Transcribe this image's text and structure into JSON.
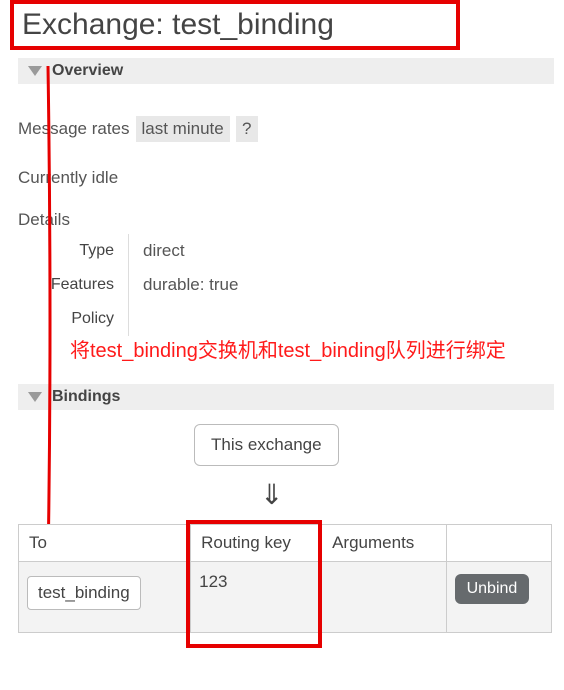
{
  "title": "Exchange: test_binding",
  "sections": {
    "overview": "Overview",
    "bindings": "Bindings"
  },
  "message_rates": {
    "label": "Message rates",
    "range": "last minute",
    "help": "?"
  },
  "idle": "Currently idle",
  "details": {
    "heading": "Details",
    "rows": {
      "type": {
        "label": "Type",
        "value": "direct"
      },
      "features": {
        "label": "Features",
        "value": "durable: true"
      },
      "policy": {
        "label": "Policy",
        "value": ""
      }
    }
  },
  "annotation": "将test_binding交换机和test_binding队列进行绑定",
  "this_exchange": "This exchange",
  "down_arrow": "⇓",
  "bindings_table": {
    "headers": {
      "to": "To",
      "routing_key": "Routing key",
      "arguments": "Arguments"
    },
    "rows": [
      {
        "to": "test_binding",
        "routing_key": "123",
        "arguments": "",
        "unbind": "Unbind"
      }
    ]
  }
}
